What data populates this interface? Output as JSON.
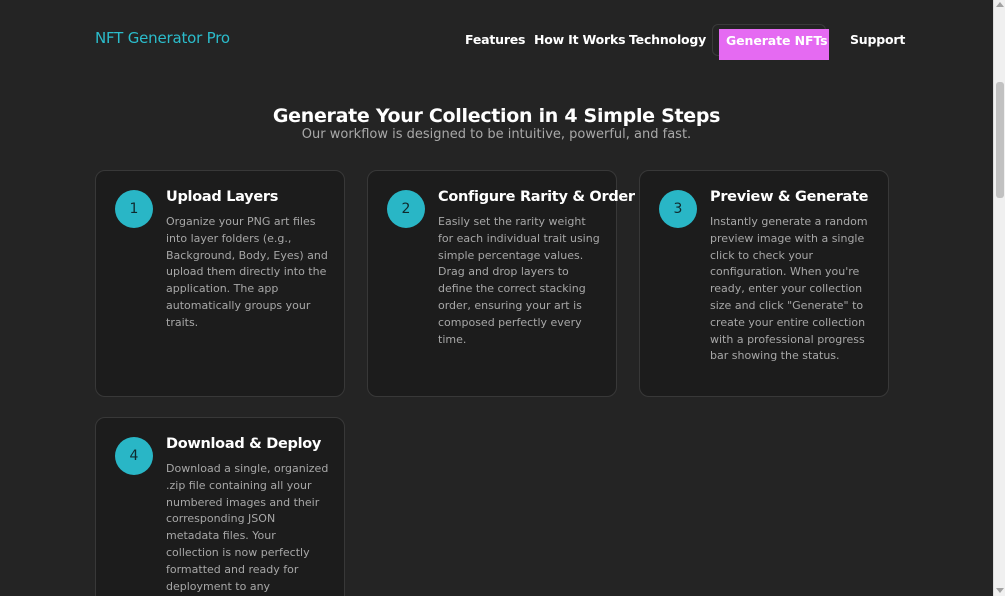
{
  "header": {
    "brand": "NFT Generator Pro",
    "nav": {
      "features": "Features",
      "how_it_works": "How It Works",
      "technology": "Technology",
      "generate": "Generate NFTs",
      "support": "Support"
    },
    "highlight_color": "#e56af2",
    "brand_color": "#2bbccb"
  },
  "section": {
    "title": "Generate Your Collection in 4 Simple Steps",
    "subtitle": "Our workflow is designed to be intuitive, powerful, and fast."
  },
  "steps": [
    {
      "number": "1",
      "title": "Upload Layers",
      "text": "Organize your PNG art files into layer folders (e.g., Background, Body, Eyes) and upload them directly into the application. The app automatically groups your traits."
    },
    {
      "number": "2",
      "title": "Configure Rarity & Order",
      "text": "Easily set the rarity weight for each individual trait using simple percentage values. Drag and drop layers to define the correct stacking order, ensuring your art is composed perfectly every time."
    },
    {
      "number": "3",
      "title": "Preview & Generate",
      "text": "Instantly generate a random preview image with a single click to check your configuration. When you're ready, enter your collection size and click \"Generate\" to create your entire collection with a professional progress bar showing the status."
    },
    {
      "number": "4",
      "title": "Download & Deploy",
      "text": "Download a single, organized .zip file containing all your numbered images and their corresponding JSON metadata files. Your collection is now perfectly formatted and ready for deployment to any blockchain."
    }
  ],
  "accent_color": "#29b6c6"
}
